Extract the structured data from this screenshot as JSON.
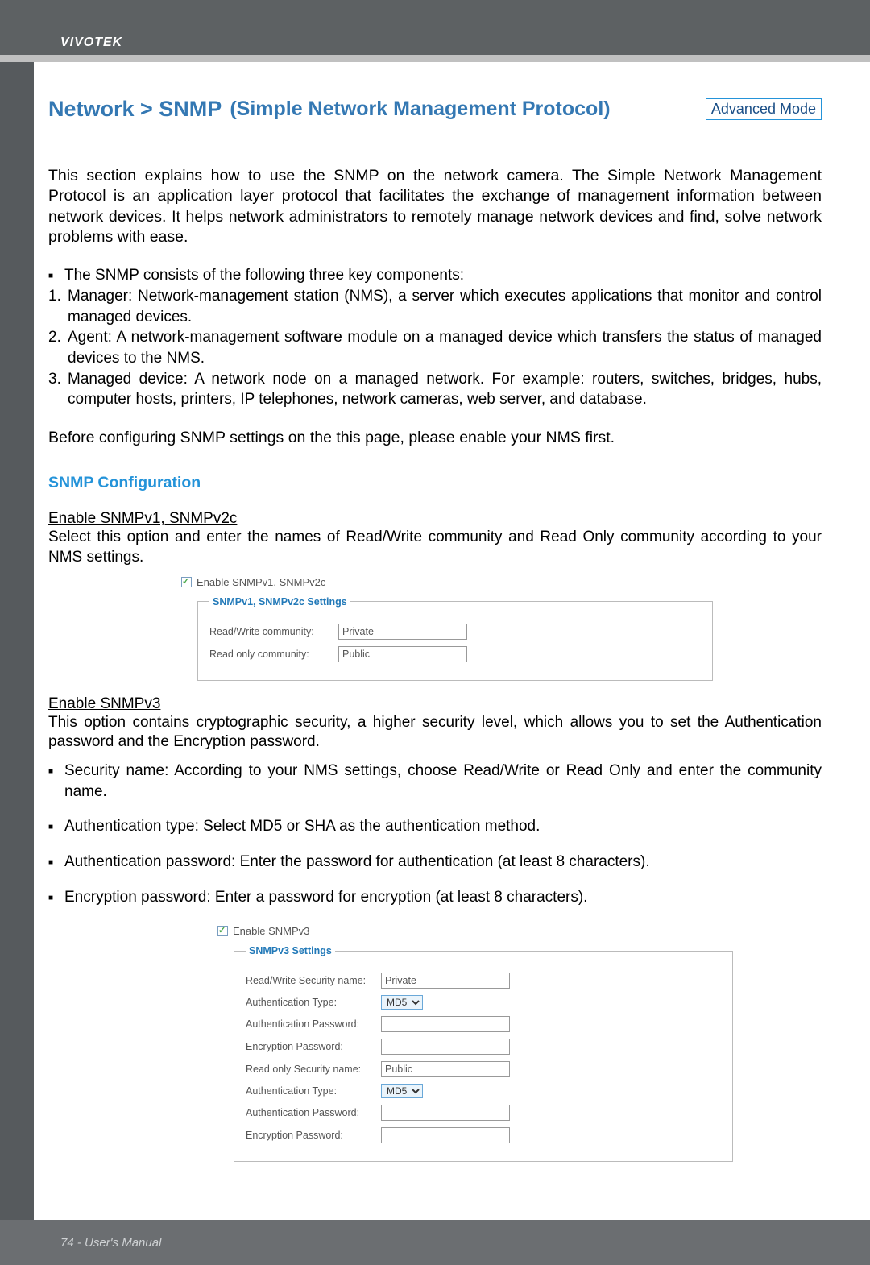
{
  "brand": "VIVOTEK",
  "title_main": "Network > SNMP",
  "title_sub": "(Simple Network Management Protocol)",
  "advanced_mode": "Advanced Mode",
  "intro": "This section explains how to use the SNMP on the network camera. The Simple Network Management Protocol is an application layer protocol that facilitates the exchange of management information between network devices. It helps network administrators to remotely manage network devices and find, solve network problems with ease.",
  "components_intro": "The SNMP consists of the following three key components:",
  "components": {
    "item1": "Manager: Network-management station (NMS), a server which executes applications that monitor and control managed devices.",
    "item2": "Agent: A network-management software module on a managed device which transfers the status of managed devices to the NMS.",
    "item3": "Managed device: A network node on a managed network. For example: routers, switches, bridges, hubs, computer hosts, printers, IP telephones, network cameras, web server, and database."
  },
  "before_note": "Before configuring SNMP settings on the this page, please enable your NMS first.",
  "section_title": "SNMP Configuration",
  "v12": {
    "heading": "Enable SNMPv1, SNMPv2c",
    "desc": "Select this option and enter the names of Read/Write community and Read Only community according to your NMS settings.",
    "checkbox_label": "Enable SNMPv1, SNMPv2c",
    "fieldset_legend": "SNMPv1, SNMPv2c Settings",
    "rw_label": "Read/Write community:",
    "rw_value": "Private",
    "ro_label": "Read only community:",
    "ro_value": "Public"
  },
  "v3": {
    "heading": "Enable SNMPv3",
    "desc": "This option contains cryptographic security, a higher security level, which allows you to set the Authentication password and the Encryption password.",
    "bullet1": "Security name: According to your NMS settings, choose Read/Write or Read Only and enter the community name.",
    "bullet2": "Authentication type: Select MD5 or SHA as the authentication method.",
    "bullet3": "Authentication password: Enter the password for authentication (at least 8 characters).",
    "bullet4": "Encryption password: Enter a password for encryption (at least 8 characters).",
    "checkbox_label": "Enable SNMPv3",
    "fieldset_legend": "SNMPv3 Settings",
    "rw_sec_label": "Read/Write Security name:",
    "rw_sec_value": "Private",
    "auth_type_label": "Authentication Type:",
    "auth_type_value": "MD5",
    "auth_pass_label": "Authentication Password:",
    "enc_pass_label": "Encryption Password:",
    "ro_sec_label": "Read only Security name:",
    "ro_sec_value": "Public"
  },
  "footer": "74 - User's Manual"
}
